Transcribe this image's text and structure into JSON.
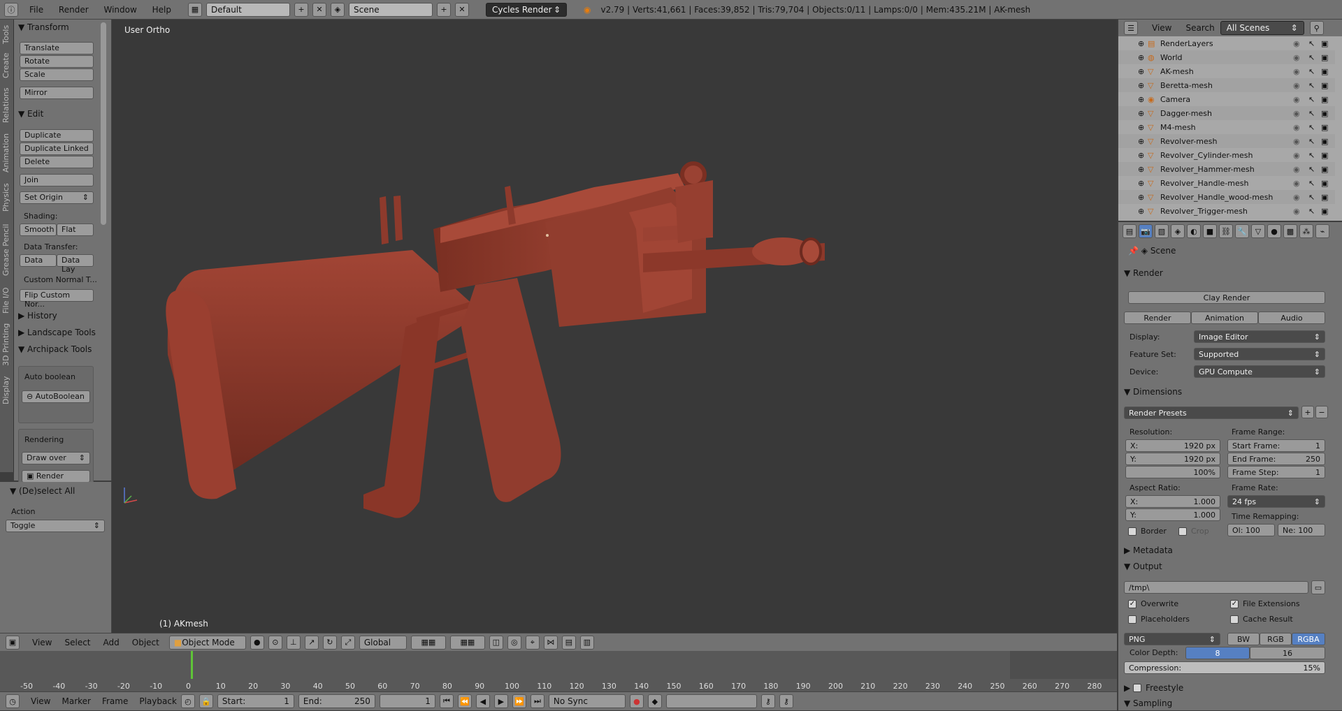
{
  "topbar": {
    "menus": [
      "File",
      "Render",
      "Window",
      "Help"
    ],
    "layout": "Default",
    "scene": "Scene",
    "engine": "Cycles Render",
    "info": "v2.79 | Verts:41,661 | Faces:39,852 | Tris:79,704 | Objects:0/11 | Lamps:0/0 | Mem:435.21M | AK-mesh"
  },
  "tabs": [
    "Tools",
    "Create",
    "Relations",
    "Animation",
    "Physics",
    "Grease Pencil",
    "File I/O",
    "3D Printing",
    "Display"
  ],
  "toolshelf": {
    "transform": "Transform",
    "translate": "Translate",
    "rotate": "Rotate",
    "scale": "Scale",
    "mirror": "Mirror",
    "edit": "Edit",
    "duplicate": "Duplicate",
    "duplicate_linked": "Duplicate Linked",
    "delete": "Delete",
    "join": "Join",
    "set_origin": "Set Origin",
    "shading": "Shading:",
    "smooth": "Smooth",
    "flat": "Flat",
    "data_transfer": "Data Transfer:",
    "data": "Data",
    "data_lay": "Data Lay",
    "custom_normal": "Custom Normal T...",
    "flip_custom": "Flip Custom Nor...",
    "history": "History",
    "landscape": "Landscape Tools",
    "archipack": "Archipack Tools",
    "auto_boolean_lbl": "Auto boolean",
    "auto_boolean_btn": "AutoBoolean",
    "rendering": "Rendering",
    "draw_over": "Draw over",
    "render": "Render"
  },
  "redo": {
    "title": "(De)select All",
    "action_lbl": "Action",
    "action": "Toggle"
  },
  "viewport": {
    "view_label": "User Ortho",
    "object_label": "(1) AKmesh"
  },
  "header3d": {
    "view": "View",
    "select": "Select",
    "add": "Add",
    "object": "Object",
    "mode": "Object Mode",
    "orientation": "Global"
  },
  "timeline": {
    "ticks": [
      "-50",
      "-40",
      "-30",
      "-20",
      "-10",
      "0",
      "10",
      "20",
      "30",
      "40",
      "50",
      "60",
      "70",
      "80",
      "90",
      "100",
      "110",
      "120",
      "130",
      "140",
      "150",
      "160",
      "170",
      "180",
      "190",
      "200",
      "210",
      "220",
      "230",
      "240",
      "250",
      "260",
      "270",
      "280"
    ]
  },
  "timehdr": {
    "view": "View",
    "marker": "Marker",
    "frame": "Frame",
    "playback": "Playback",
    "start_lbl": "Start:",
    "start": "1",
    "end_lbl": "End:",
    "end": "250",
    "current": "1",
    "sync": "No Sync"
  },
  "outliner": {
    "view": "View",
    "search": "Search",
    "filter": "All Scenes",
    "items": [
      "RenderLayers",
      "World",
      "AK-mesh",
      "Beretta-mesh",
      "Camera",
      "Dagger-mesh",
      "M4-mesh",
      "Revolver-mesh",
      "Revolver_Cylinder-mesh",
      "Revolver_Hammer-mesh",
      "Revolver_Handle-mesh",
      "Revolver_Handle_wood-mesh",
      "Revolver_Trigger-mesh"
    ]
  },
  "props": {
    "scene": "Scene",
    "render_sec": "Render",
    "clay": "Clay Render",
    "render": "Render",
    "animation": "Animation",
    "audio": "Audio",
    "display_lbl": "Display:",
    "display": "Image Editor",
    "feature_lbl": "Feature Set:",
    "feature": "Supported",
    "device_lbl": "Device:",
    "device": "GPU Compute",
    "dimensions": "Dimensions",
    "presets": "Render Presets",
    "resolution": "Resolution:",
    "res_x_lbl": "X:",
    "res_x": "1920 px",
    "res_y_lbl": "Y:",
    "res_y": "1920 px",
    "res_pct": "100%",
    "frame_range": "Frame Range:",
    "start_lbl": "Start Frame:",
    "start": "1",
    "end_lbl": "End Frame:",
    "end": "250",
    "step_lbl": "Frame Step:",
    "step": "1",
    "aspect": "Aspect Ratio:",
    "asp_x_lbl": "X:",
    "asp_x": "1.000",
    "asp_y_lbl": "Y:",
    "asp_y": "1.000",
    "frame_rate": "Frame Rate:",
    "fps": "24 fps",
    "time_remap": "Time Remapping:",
    "old": "Ol: 100",
    "new": "Ne: 100",
    "border": "Border",
    "crop": "Crop",
    "metadata": "Metadata",
    "output": "Output",
    "path": "/tmp\\",
    "overwrite": "Overwrite",
    "file_ext": "File Extensions",
    "placeholders": "Placeholders",
    "cache": "Cache Result",
    "format": "PNG",
    "bw": "BW",
    "rgb": "RGB",
    "rgba": "RGBA",
    "color_depth": "Color Depth:",
    "depth8": "8",
    "depth16": "16",
    "compression": "Compression:",
    "compression_val": "15%",
    "freestyle": "Freestyle",
    "sampling": "Sampling"
  },
  "colors": {
    "model": "#8c3a2c",
    "viewport_bg": "#393939",
    "accent": "#5680c2"
  }
}
